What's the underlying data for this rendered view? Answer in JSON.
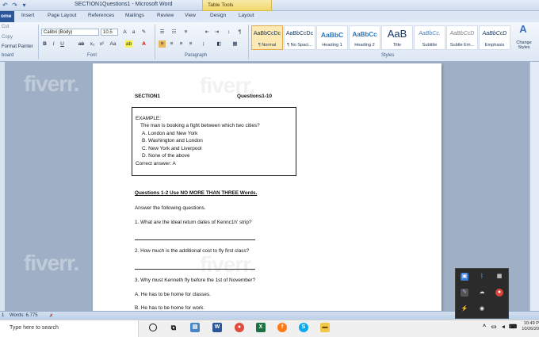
{
  "window": {
    "title": "SECTION1Questions1 - Microsoft Word",
    "contextual_tab_group": "Table Tools"
  },
  "tabs": [
    "ome",
    "Insert",
    "Page Layout",
    "References",
    "Mailings",
    "Review",
    "View",
    "Design",
    "Layout"
  ],
  "ribbon": {
    "clipboard": {
      "cut": "Cut",
      "copy": "Copy",
      "format_painter": "Format Painter",
      "label": "board"
    },
    "font": {
      "name": "Calibri (Body)",
      "size": "10.5",
      "label": "Font"
    },
    "paragraph": {
      "label": "Paragraph"
    },
    "styles": {
      "label": "Styles",
      "items": [
        {
          "preview": "AaBbCcDc",
          "name": "¶ Normal"
        },
        {
          "preview": "AaBbCcDc",
          "name": "¶ No Spaci..."
        },
        {
          "preview": "AaBbC",
          "name": "Heading 1"
        },
        {
          "preview": "AaBbCc",
          "name": "Heading 2"
        },
        {
          "preview": "AaB",
          "name": "Title"
        },
        {
          "preview": "AaBbCc.",
          "name": "Subtitle"
        },
        {
          "preview": "AaBbCcD",
          "name": "Subtle Em..."
        },
        {
          "preview": "AaBbCcD",
          "name": "Emphasis"
        }
      ],
      "change_styles": "Change Styles"
    }
  },
  "document": {
    "section_heading": "SECTION1",
    "questions_heading": "Questions1-10",
    "example": {
      "label": "EXAMPLE:",
      "question": "The man is booking a fight between which two cities?",
      "options": [
        "A. London and New York",
        "B. Washington and London",
        "C. New York and Liverpool",
        "D. None of the above"
      ],
      "answer": "Correct answer: A"
    },
    "instruction_heading": "Questions 1-2 Use NO MORE THAN THREE Words.",
    "instruction": "Answer the following questions.",
    "q1": "1. What are the ideal return dates of Kennc1h' strip?",
    "q2": "2. How much is the additional cost to fly first class?",
    "q3": "3. Why must Kenneth fly before the 1st of November?",
    "q3_a": "A. He has to be home for classes.",
    "q3_b": "B. He has to be home for work."
  },
  "watermark": "fiverr.",
  "statusbar": {
    "page": "1",
    "words": "Words: 6,775"
  },
  "taskbar": {
    "search_placeholder": "Type here to search",
    "time": "10:49 P",
    "date": "10/26/20"
  }
}
